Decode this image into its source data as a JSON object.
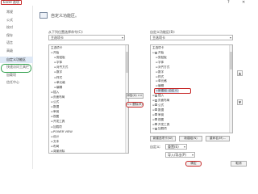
{
  "window": {
    "title": "Excel 选项",
    "help_glyph": "?",
    "close_glyph": "✕"
  },
  "sidebar": {
    "items": [
      {
        "label": "常规"
      },
      {
        "label": "公式"
      },
      {
        "label": "校对"
      },
      {
        "label": "保存"
      },
      {
        "label": "语言"
      },
      {
        "label": "高级"
      },
      {
        "label": "自定义功能区"
      },
      {
        "label": "快速访问工具栏"
      },
      {
        "label": "加载项"
      },
      {
        "label": "信任中心"
      }
    ],
    "active_index": 6
  },
  "main": {
    "header": "自定义功能区。",
    "left": {
      "label": "从下列位置选择命令(C):",
      "select_value": "主选项卡",
      "list_header": "主选项卡",
      "items": [
        {
          "label": "开始",
          "level": 0,
          "expander": "⊟"
        },
        {
          "label": "剪贴板",
          "level": 1,
          "expander": "⊞"
        },
        {
          "label": "字体",
          "level": 1,
          "expander": "⊞"
        },
        {
          "label": "对齐方式",
          "level": 1,
          "expander": "⊞"
        },
        {
          "label": "数字",
          "level": 1,
          "expander": "⊞"
        },
        {
          "label": "样式",
          "level": 1,
          "expander": "⊞"
        },
        {
          "label": "单元格",
          "level": 1,
          "expander": "⊞"
        },
        {
          "label": "编辑",
          "level": 1,
          "expander": "⊞"
        },
        {
          "label": "插入",
          "level": 0,
          "expander": "⊞"
        },
        {
          "label": "页面布局",
          "level": 0,
          "expander": "⊞"
        },
        {
          "label": "公式",
          "level": 0,
          "expander": "⊞"
        },
        {
          "label": "数据",
          "level": 0,
          "expander": "⊞"
        },
        {
          "label": "审阅",
          "level": 0,
          "expander": "⊞"
        },
        {
          "label": "视图",
          "level": 0,
          "expander": "⊞"
        },
        {
          "label": "开发工具",
          "level": 0,
          "expander": "⊞"
        },
        {
          "label": "加载项",
          "level": 0,
          "expander": "⊞"
        },
        {
          "label": "POWER VIEW",
          "level": 0,
          "expander": "⊞"
        },
        {
          "label": "设计",
          "level": 0,
          "expander": "⊞"
        },
        {
          "label": "文本",
          "level": 0,
          "expander": "⊞"
        },
        {
          "label": "布局",
          "level": 0,
          "expander": "⊞"
        },
        {
          "label": "背景消除",
          "level": 0,
          "expander": "⊞"
        }
      ]
    },
    "middle": {
      "add_label": "添加(A) >>",
      "remove_label": "<< 删除(R)"
    },
    "right": {
      "label": "自定义功能区(B):",
      "select_value": "主选项卡",
      "list_header": "主选项卡",
      "items": [
        {
          "label": "开始",
          "level": 0,
          "expander": "⊟",
          "checked": true
        },
        {
          "label": "剪贴板",
          "level": 1,
          "expander": "⊞"
        },
        {
          "label": "字体",
          "level": 1,
          "expander": "⊞"
        },
        {
          "label": "对齐方式",
          "level": 1,
          "expander": "⊞"
        },
        {
          "label": "数字",
          "level": 1,
          "expander": "⊞"
        },
        {
          "label": "样式",
          "level": 1,
          "expander": "⊞"
        },
        {
          "label": "单元格",
          "level": 1,
          "expander": "⊞"
        },
        {
          "label": "编辑",
          "level": 1,
          "expander": "⊞"
        },
        {
          "label": "新建组 (自定义)",
          "level": 1,
          "expander": "⊞",
          "selected": true
        },
        {
          "label": "插入",
          "level": 0,
          "expander": "⊞",
          "checked": true
        },
        {
          "label": "页面布局",
          "level": 0,
          "expander": "⊞",
          "checked": true
        },
        {
          "label": "公式",
          "level": 0,
          "expander": "⊞",
          "checked": true
        },
        {
          "label": "数据",
          "level": 0,
          "expander": "⊞",
          "checked": true
        },
        {
          "label": "审阅",
          "level": 0,
          "expander": "⊞",
          "checked": true
        },
        {
          "label": "视图",
          "level": 0,
          "expander": "⊞",
          "checked": true
        },
        {
          "label": "开发工具",
          "level": 0,
          "expander": "⊞",
          "checked": true
        },
        {
          "label": "加载项",
          "level": 0,
          "expander": "⊞",
          "checked": true
        }
      ],
      "up_glyph": "▲",
      "down_glyph": "▼",
      "new_tab_label": "新建选项卡(W)",
      "new_group_label": "新建组(N)",
      "rename_label": "重命名(M)...",
      "customize_label": "自定义:",
      "reset_value": "重置(E)",
      "import_export_value": "导入/导出(P)"
    },
    "footer": {
      "ok_label": "确定",
      "cancel_label": "取消"
    }
  },
  "colors": {
    "annotation_red": "#c62828",
    "annotation_green": "#2e9e4a",
    "active_sidebar_bg": "#dfe9f6"
  }
}
